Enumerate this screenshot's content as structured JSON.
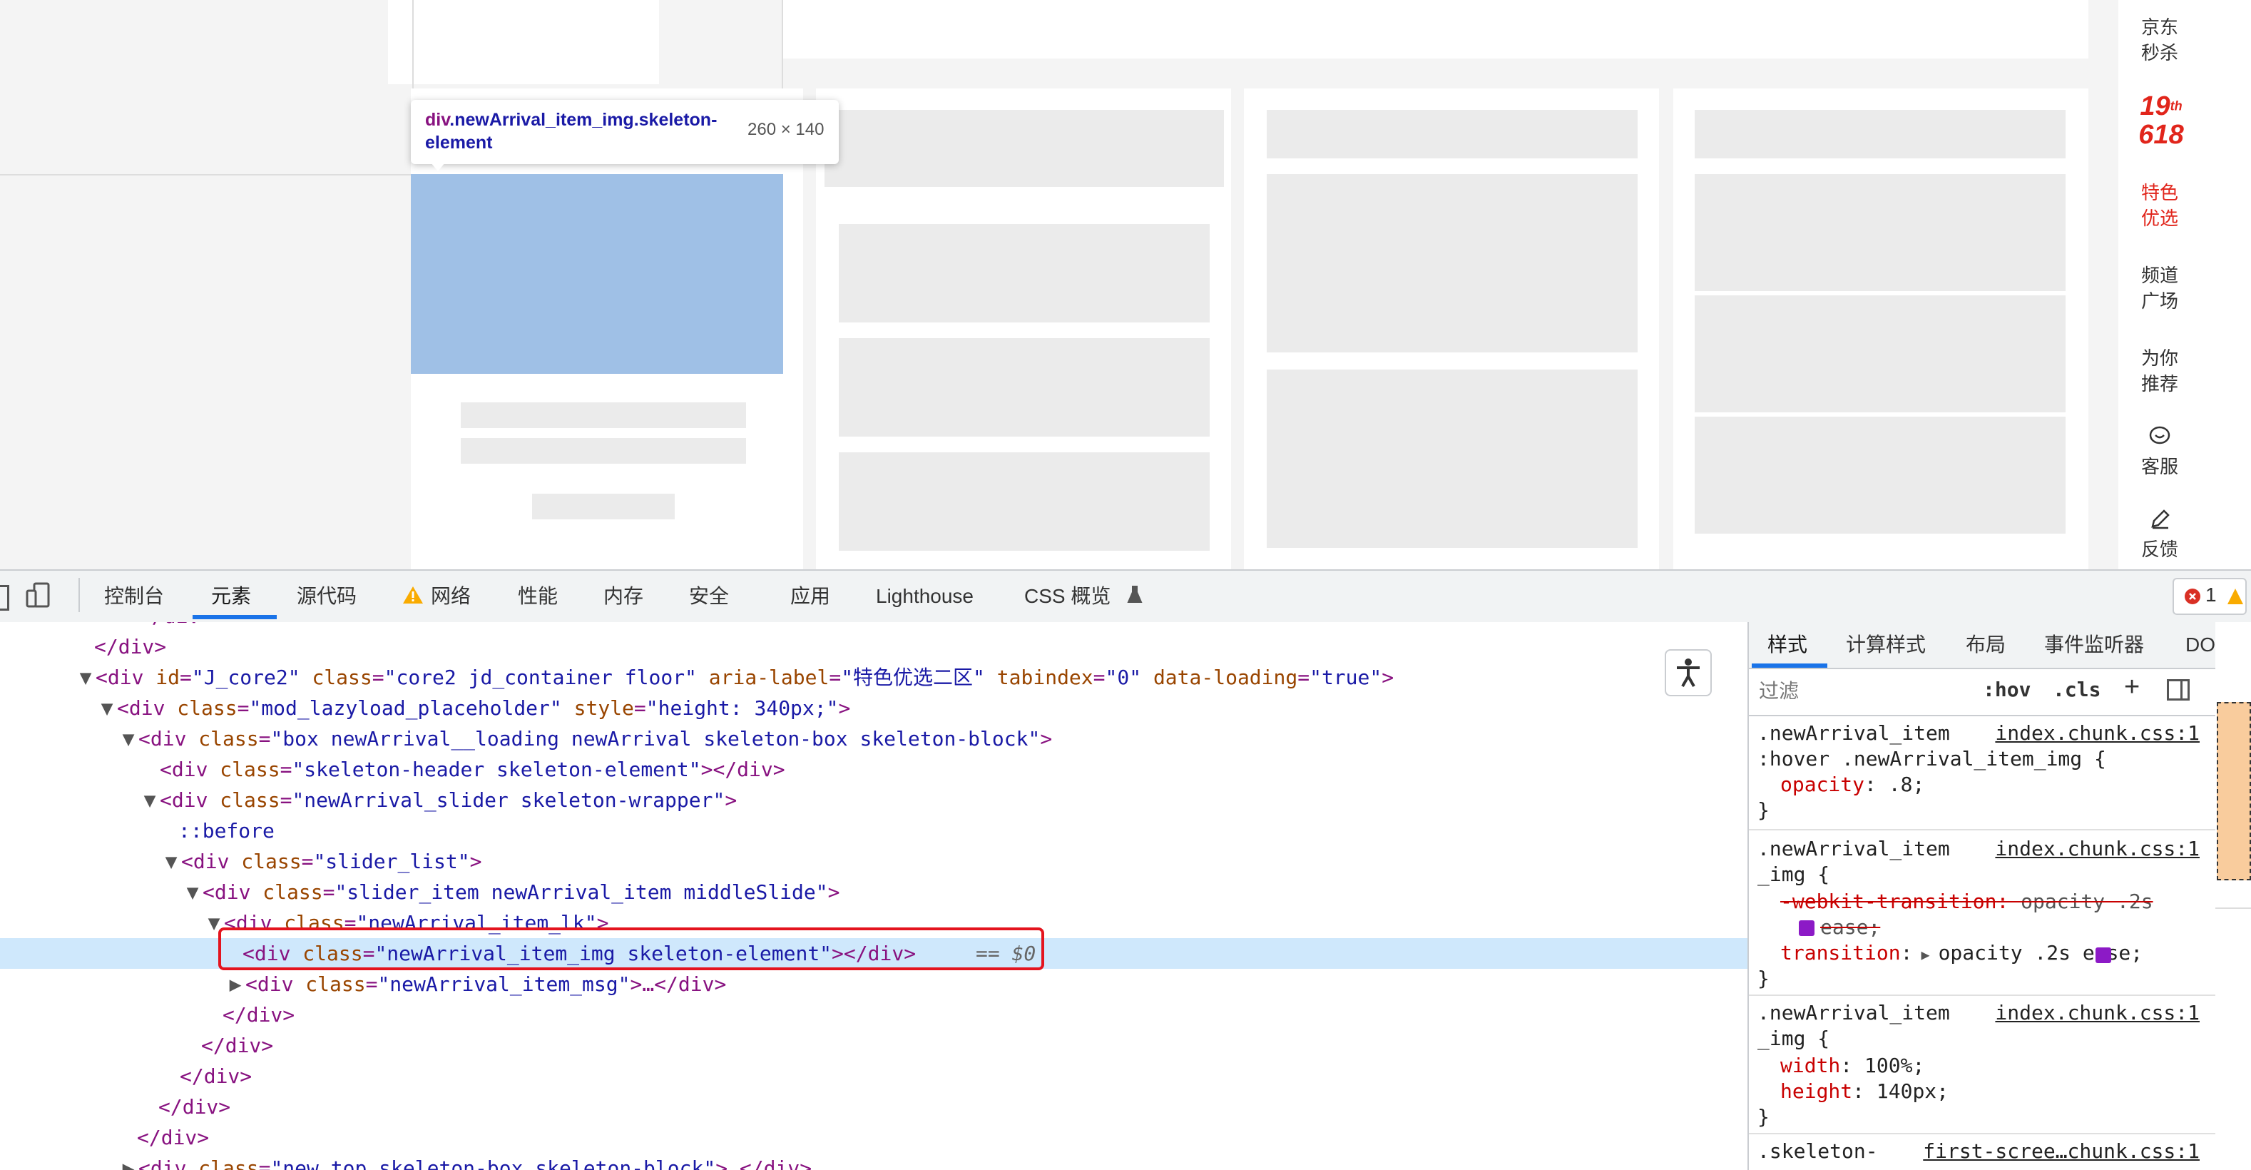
{
  "tooltip": {
    "tag": "div",
    "name": ".newArrival_item_img.skeleton-element",
    "size": "260 × 140"
  },
  "sidebar": {
    "items": [
      {
        "label": "京东\n秒杀",
        "red": false
      },
      {
        "label": "特色\n优选",
        "red": true
      },
      {
        "label": "频道\n广场",
        "red": false
      },
      {
        "label": "为你\n推荐",
        "red": false
      },
      {
        "label": "客服",
        "red": false
      },
      {
        "label": "反馈",
        "red": false
      }
    ],
    "logo_top": "19",
    "logo_sup": "th",
    "logo_bottom": "618"
  },
  "devtools_tabs": [
    "控制台",
    "元素",
    "源代码",
    "网络",
    "性能",
    "内存",
    "安全",
    "应用",
    "Lighthouse",
    "CSS 概览"
  ],
  "error_count": "1",
  "dom_lines": [
    "</div>",
    "<div id=\"J_core2\" class=\"core2 jd_container floor\" aria-label=\"特色优选二区\" tabindex=\"0\" data-loading=\"true\">",
    "<div class=\"mod_lazyload_placeholder\" style=\"height: 340px;\">",
    "<div class=\"box newArrival__loading newArrival skeleton-box skeleton-block\">",
    "<div class=\"skeleton-header skeleton-element\"></div>",
    "<div class=\"newArrival_slider skeleton-wrapper\">",
    "::before",
    "<div class=\"slider_list\">",
    "<div class=\"slider_item newArrival_item middleSlide\">",
    "<div class=\"newArrival_item_lk\">",
    "<div class=\"newArrival_item_img skeleton-element\"></div>",
    "<div class=\"newArrival_item_msg\">…</div>",
    "</div>",
    "</div>",
    "</div>",
    "</div>",
    "<div class=\"new_top skeleton-box skeleton-block\">…</div>"
  ],
  "selected_suffix": "== $0",
  "styles_tabs": [
    "样式",
    "计算样式",
    "布局",
    "事件监听器",
    "DOM 断"
  ],
  "filter_placeholder": "过滤",
  "filter_buttons": [
    ":hov",
    ".cls",
    "+"
  ],
  "rules": [
    {
      "selector": ".newArrival_item\n:hover .newArrival_item_img {",
      "source": "index.chunk.css:1",
      "decls": [
        {
          "prop": "opacity",
          "val": ".8;"
        }
      ]
    },
    {
      "selector": ".newArrival_item\n_img {",
      "source": "index.chunk.css:1",
      "decls": [
        {
          "prop": "-webkit-transition",
          "val": "opacity .2s",
          "strike": true
        },
        {
          "prop": "",
          "val": "ease;",
          "strike": true
        },
        {
          "prop": "transition",
          "val": "opacity .2s ease;"
        }
      ]
    },
    {
      "selector": ".newArrival_item\n_img {",
      "source": "index.chunk.css:1",
      "decls": [
        {
          "prop": "width",
          "val": "100%;"
        },
        {
          "prop": "height",
          "val": "140px;"
        }
      ]
    },
    {
      "selector": ".skeleton-",
      "source": "first-scree…chunk.css:1",
      "decls": []
    }
  ]
}
